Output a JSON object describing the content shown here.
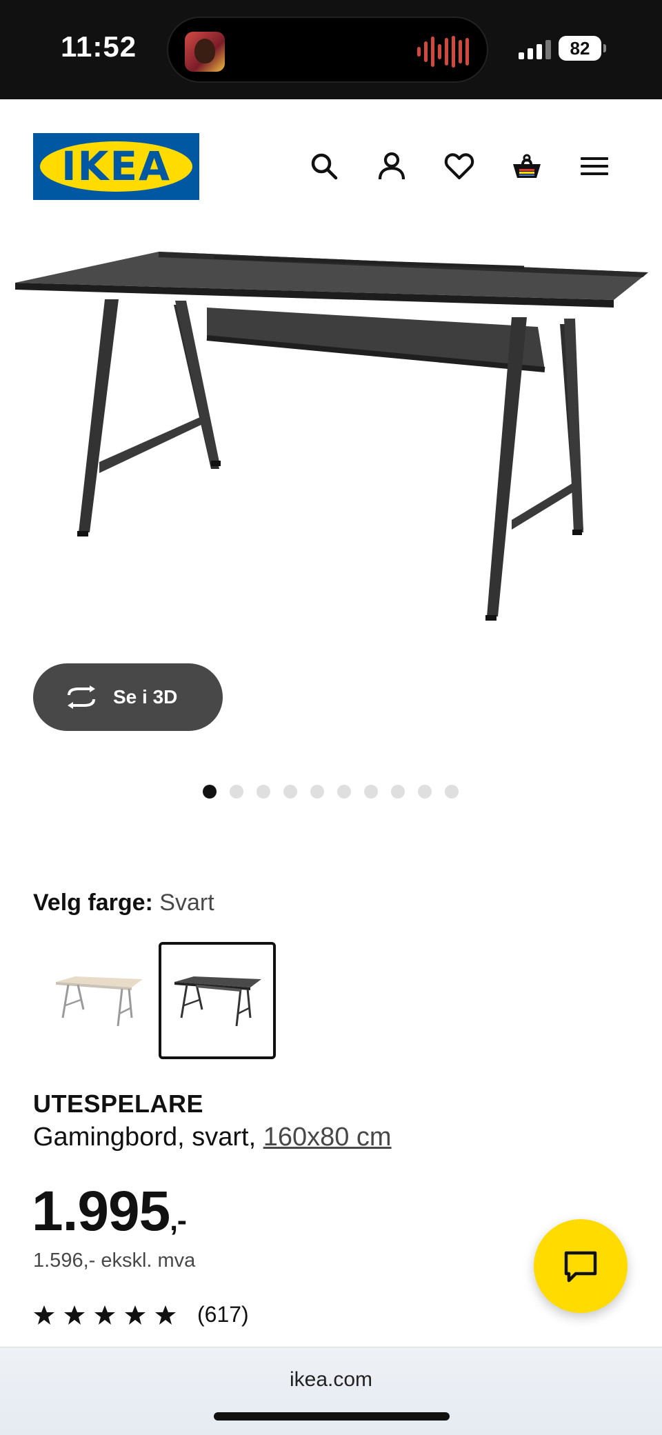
{
  "status_bar": {
    "time": "11:52",
    "battery": "82"
  },
  "header": {
    "logo_text": "IKEA"
  },
  "image_viewer": {
    "view_3d_label": "Se i 3D",
    "total_images": 10,
    "active_index": 0
  },
  "color_select": {
    "label": "Velg farge:",
    "value": "Svart",
    "swatches": [
      {
        "name": "white-oak",
        "selected": false
      },
      {
        "name": "black",
        "selected": true
      }
    ]
  },
  "product": {
    "name": "UTESPELARE",
    "description": "Gamingbord, svart, ",
    "size": "160x80 cm",
    "price": "1.995",
    "price_suffix": ",-",
    "price_ex_vat": "1.596,- ekskl. mva",
    "rating_stars": 5,
    "review_count": "(617)"
  },
  "browser": {
    "url": "ikea.com"
  },
  "colors": {
    "ikea_blue": "#0058a3",
    "ikea_yellow": "#ffdb00",
    "dark_button": "#484848"
  }
}
